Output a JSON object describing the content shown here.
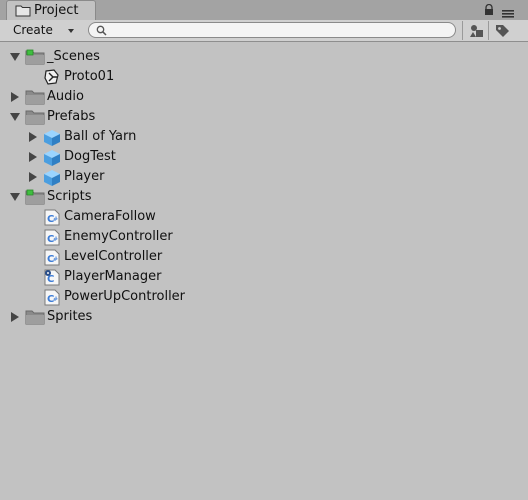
{
  "window": {
    "tab_title": "Project"
  },
  "toolbar": {
    "create_label": "Create",
    "search_value": ""
  },
  "tree": {
    "scenes": {
      "label": "_Scenes",
      "children": [
        "Proto01"
      ]
    },
    "audio": {
      "label": "Audio"
    },
    "prefabs": {
      "label": "Prefabs",
      "children": [
        "Ball of Yarn",
        "DogTest",
        "Player"
      ]
    },
    "scripts": {
      "label": "Scripts",
      "children": [
        "CameraFollow",
        "EnemyController",
        "LevelController",
        "PlayerManager",
        "PowerUpController"
      ]
    },
    "sprites": {
      "label": "Sprites"
    }
  },
  "colors": {
    "panel_bg": "#c2c2c2",
    "titlebar_bg": "#a3a3a3",
    "folder": "#8a8a8a",
    "prefab_cube": "#5aa9e6",
    "script_accent": "#3b7bd6"
  }
}
